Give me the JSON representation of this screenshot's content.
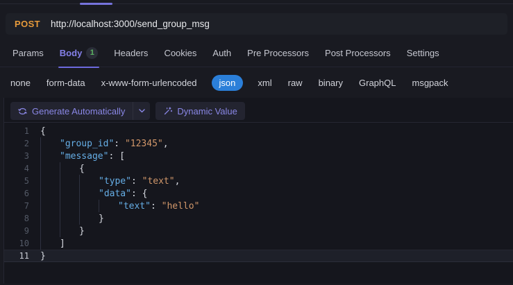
{
  "url_bar": {
    "method": "POST",
    "url": "http://localhost:3000/send_group_msg"
  },
  "tabs": [
    {
      "label": "Params"
    },
    {
      "label": "Body",
      "badge": "1",
      "active": true
    },
    {
      "label": "Headers"
    },
    {
      "label": "Cookies"
    },
    {
      "label": "Auth"
    },
    {
      "label": "Pre Processors"
    },
    {
      "label": "Post Processors"
    },
    {
      "label": "Settings"
    }
  ],
  "body_types": [
    {
      "label": "none"
    },
    {
      "label": "form-data"
    },
    {
      "label": "x-www-form-urlencoded"
    },
    {
      "label": "json",
      "selected": true
    },
    {
      "label": "xml"
    },
    {
      "label": "raw"
    },
    {
      "label": "binary"
    },
    {
      "label": "GraphQL"
    },
    {
      "label": "msgpack"
    }
  ],
  "toolbar": {
    "generate_label": "Generate Automatically",
    "dynamic_label": "Dynamic Value",
    "icons": [
      "sync-cycle-icon",
      "chevron-down-icon",
      "magic-wand-icon"
    ]
  },
  "editor": {
    "language": "json",
    "lines": [
      {
        "n": "1",
        "tokens": [
          {
            "c": "p",
            "t": "{"
          }
        ]
      },
      {
        "n": "2",
        "tokens": [
          {
            "c": "k",
            "t": "\"group_id\""
          },
          {
            "c": "p",
            "t": ": "
          },
          {
            "c": "s",
            "t": "\"12345\""
          },
          {
            "c": "p",
            "t": ","
          }
        ]
      },
      {
        "n": "3",
        "tokens": [
          {
            "c": "k",
            "t": "\"message\""
          },
          {
            "c": "p",
            "t": ": ["
          }
        ]
      },
      {
        "n": "4",
        "tokens": [
          {
            "c": "p",
            "t": "{"
          }
        ]
      },
      {
        "n": "5",
        "tokens": [
          {
            "c": "k",
            "t": "\"type\""
          },
          {
            "c": "p",
            "t": ": "
          },
          {
            "c": "s",
            "t": "\"text\""
          },
          {
            "c": "p",
            "t": ","
          }
        ]
      },
      {
        "n": "6",
        "tokens": [
          {
            "c": "k",
            "t": "\"data\""
          },
          {
            "c": "p",
            "t": ": {"
          }
        ]
      },
      {
        "n": "7",
        "tokens": [
          {
            "c": "k",
            "t": "\"text\""
          },
          {
            "c": "p",
            "t": ": "
          },
          {
            "c": "s",
            "t": "\"hello\""
          }
        ]
      },
      {
        "n": "8",
        "tokens": [
          {
            "c": "p",
            "t": "}"
          }
        ]
      },
      {
        "n": "9",
        "tokens": [
          {
            "c": "p",
            "t": "}"
          }
        ]
      },
      {
        "n": "10",
        "tokens": [
          {
            "c": "p",
            "t": "]"
          }
        ]
      },
      {
        "n": "11",
        "tokens": [
          {
            "c": "p",
            "t": "}"
          }
        ],
        "active": true
      }
    ]
  },
  "colors": {
    "method_orange": "#e69a3b",
    "accent_purple": "#8480e8",
    "tab_underline": "#6d6ade",
    "json_pill_blue": "#2b7fd9",
    "badge_green": "#5cb563",
    "syntax_key": "#66aee6",
    "syntax_string": "#d1976a",
    "editor_bg": "#15161d"
  }
}
